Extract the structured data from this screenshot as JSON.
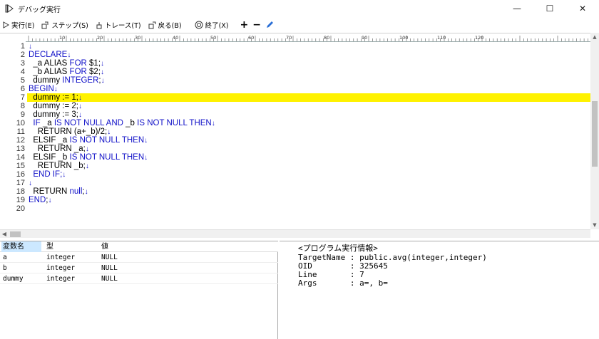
{
  "window": {
    "title": "デバッグ実行",
    "controls": {
      "minimize": "—",
      "maximize": "☐",
      "close": "✕"
    }
  },
  "toolbar": {
    "run": "実行(E)",
    "step": "ステップ(S)",
    "trace": "トレース(T)",
    "back": "戻る(B)",
    "quit": "終了(X)",
    "plus": "+",
    "minus": "−",
    "icons": [
      "play-icon",
      "step-icon",
      "trace-icon",
      "back-icon",
      "quit-icon",
      "plus-icon",
      "minus-icon",
      "pencil-icon"
    ]
  },
  "ruler": {
    "labels": [
      "10",
      "20",
      "30",
      "40",
      "50",
      "60",
      "70",
      "80",
      "90",
      "100",
      "110",
      "120"
    ]
  },
  "editor": {
    "current_line": 7,
    "highlight_color": "#fff200",
    "keyword_color": "#1010c8",
    "line_numbers": [
      "1",
      "2",
      "3",
      "4",
      "5",
      "6",
      "7",
      "8",
      "9",
      "10",
      "11",
      "12",
      "13",
      "14",
      "15",
      "16",
      "17",
      "18",
      "19",
      "20"
    ],
    "lines": [
      [
        {
          "t": "↓",
          "k": "br"
        }
      ],
      [
        {
          "t": "DECLARE",
          "k": "kw"
        },
        {
          "t": "↓",
          "k": "br"
        }
      ],
      [
        {
          "t": "  _a ALIAS ",
          "k": "id"
        },
        {
          "t": "FOR",
          "k": "kw"
        },
        {
          "t": " $1;",
          "k": "id"
        },
        {
          "t": "↓",
          "k": "br"
        }
      ],
      [
        {
          "t": "  _b ALIAS ",
          "k": "id"
        },
        {
          "t": "FOR",
          "k": "kw"
        },
        {
          "t": " $2;",
          "k": "id"
        },
        {
          "t": "↓",
          "k": "br"
        }
      ],
      [
        {
          "t": "  dummy ",
          "k": "id"
        },
        {
          "t": "INTEGER",
          "k": "kw"
        },
        {
          "t": ";",
          "k": "id"
        },
        {
          "t": "↓",
          "k": "br"
        }
      ],
      [
        {
          "t": "BEGIN",
          "k": "kw"
        },
        {
          "t": "↓",
          "k": "br"
        }
      ],
      [
        {
          "t": "  dummy := 1;",
          "k": "id"
        },
        {
          "t": "↓",
          "k": "br"
        }
      ],
      [
        {
          "t": "  dummy := 2;",
          "k": "id"
        },
        {
          "t": "↓",
          "k": "br"
        }
      ],
      [
        {
          "t": "  dummy := 3;",
          "k": "id"
        },
        {
          "t": "↓",
          "k": "br"
        }
      ],
      [
        {
          "t": "  ",
          "k": "id"
        },
        {
          "t": "IF",
          "k": "kw"
        },
        {
          "t": " _a ",
          "k": "id"
        },
        {
          "t": "IS NOT NULL AND",
          "k": "kw"
        },
        {
          "t": " _b ",
          "k": "id"
        },
        {
          "t": "IS NOT NULL THEN",
          "k": "kw"
        },
        {
          "t": "↓",
          "k": "br"
        }
      ],
      [
        {
          "t": "    RETURN (a+_b)/2;",
          "k": "id"
        },
        {
          "t": "↓",
          "k": "br"
        }
      ],
      [
        {
          "t": "  ELSIF _a ",
          "k": "id"
        },
        {
          "t": "IS NOT NULL THEN",
          "k": "kw"
        },
        {
          "t": "↓",
          "k": "br"
        }
      ],
      [
        {
          "t": "    RETURN _a;",
          "k": "id"
        },
        {
          "t": "↓",
          "k": "br"
        }
      ],
      [
        {
          "t": "  ELSIF _b ",
          "k": "id"
        },
        {
          "t": "IS NOT NULL THEN",
          "k": "kw"
        },
        {
          "t": "↓",
          "k": "br"
        }
      ],
      [
        {
          "t": "    RETURN _b;",
          "k": "id"
        },
        {
          "t": "↓",
          "k": "br"
        }
      ],
      [
        {
          "t": "  END IF;",
          "k": "kw"
        },
        {
          "t": "↓",
          "k": "br"
        }
      ],
      [
        {
          "t": "↓",
          "k": "br"
        }
      ],
      [
        {
          "t": "  RETURN ",
          "k": "id"
        },
        {
          "t": "null",
          "k": "kw"
        },
        {
          "t": ";",
          "k": "id"
        },
        {
          "t": "↓",
          "k": "br"
        }
      ],
      [
        {
          "t": "END",
          "k": "kw"
        },
        {
          "t": ";",
          "k": "id"
        },
        {
          "t": "↓",
          "k": "br"
        }
      ],
      []
    ]
  },
  "variables": {
    "headers": [
      "変数名",
      "型",
      "値"
    ],
    "rows": [
      [
        "a",
        "integer",
        "NULL"
      ],
      [
        "b",
        "integer",
        "NULL"
      ],
      [
        "dummy",
        "integer",
        "NULL"
      ]
    ]
  },
  "program_info": {
    "heading": "<プログラム実行情報>",
    "lines": [
      "TargetName : public.avg(integer,integer)",
      "OID        : 325645",
      "Line       : 7",
      "Args       : a=, b="
    ]
  }
}
